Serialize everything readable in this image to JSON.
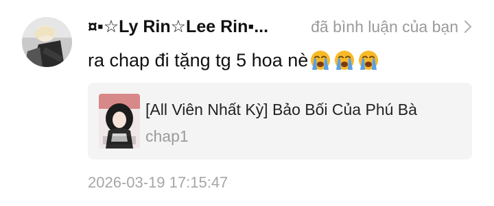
{
  "comment": {
    "username": "¤▪☆Ly Rin☆Lee Rin▪...",
    "action": "đã bình luận của bạn",
    "text": "ra chap đi tặng tg 5 hoa nè",
    "emoji_icons": [
      "loudly-crying-face-icon",
      "loudly-crying-face-icon",
      "loudly-crying-face-icon"
    ],
    "timestamp": "2026-03-19 17:15:47"
  },
  "story": {
    "title": "[All Viên Nhất Kỳ] Bảo Bối Của Phú Bà",
    "chapter": "chap1"
  },
  "colors": {
    "username": "#111111",
    "muted": "#9a9a9a",
    "card_background": "#f4f4f4",
    "emoji_face": "#f7b928",
    "emoji_tears": "#5aa0e6"
  }
}
